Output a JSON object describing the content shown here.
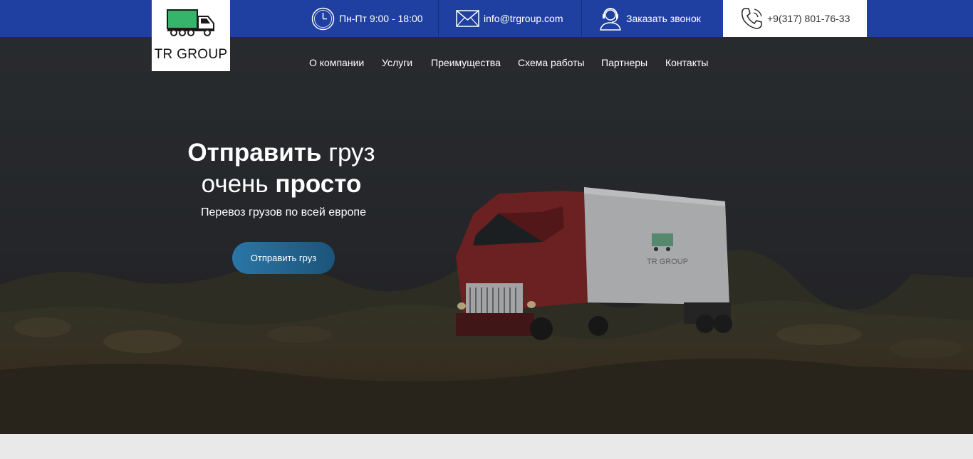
{
  "header": {
    "logo_text": "TR GROUP",
    "hours": "Пн-Пт 9:00 - 18:00",
    "email": "info@trgroup.com",
    "callback_label": "Заказать звонок",
    "phone": "+9(317) 801-76-33"
  },
  "nav": {
    "items": [
      "О компании",
      "Услуги",
      "Преимущества",
      "Схема работы",
      "Партнеры",
      "Контакты"
    ]
  },
  "hero": {
    "title_bold_1": "Отправить",
    "title_light_1": "груз",
    "title_light_2": "очень",
    "title_bold_2": "просто",
    "subtitle": "Перевоз грузов по всей европе",
    "cta_label": "Отправить груз",
    "trailer_text": "TR GROUP"
  },
  "colors": {
    "topbar": "#1f40a0",
    "logo_truck": "#36b46a",
    "cta": "#2a76a6"
  },
  "icons": [
    "clock-icon",
    "mail-icon",
    "operator-icon",
    "phone-icon",
    "truck-logo-icon"
  ]
}
